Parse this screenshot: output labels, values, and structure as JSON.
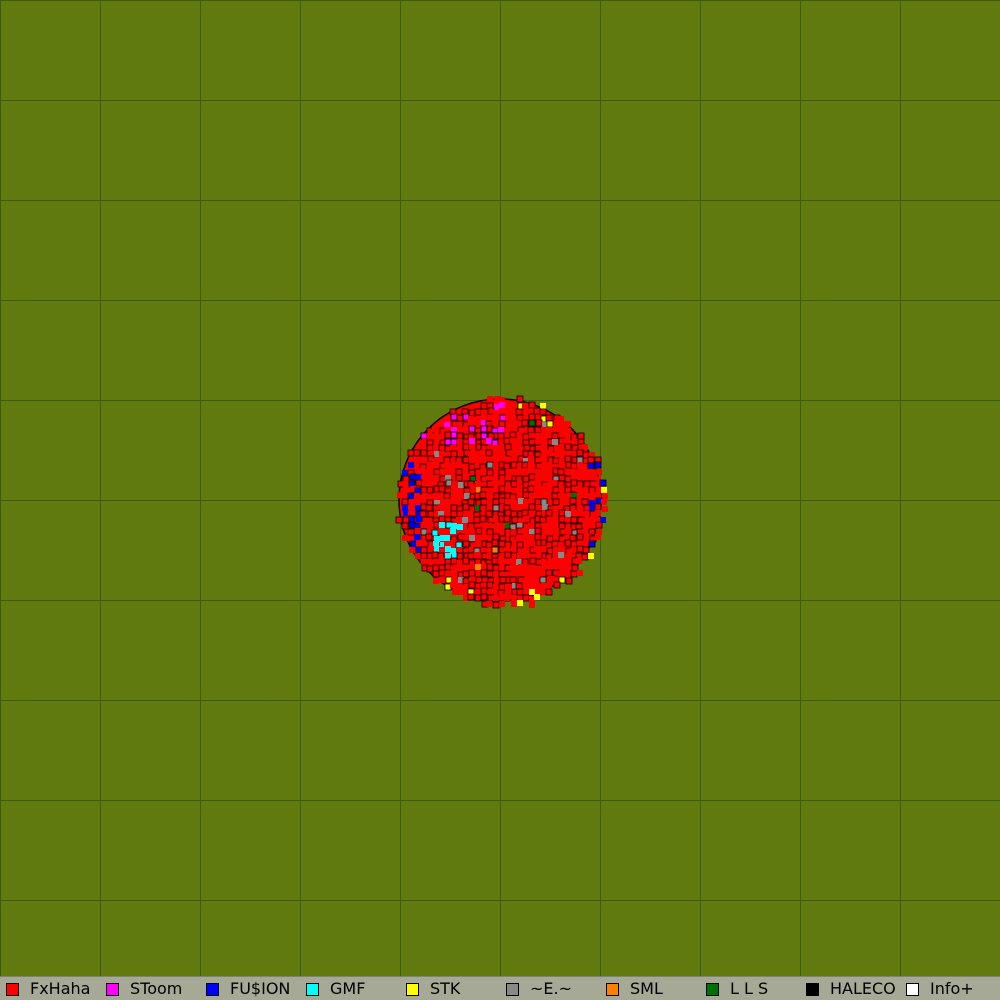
{
  "map": {
    "background_color": "#617a0d",
    "grid_color": "#3c5a10",
    "territory": {
      "dominant_player": "FxHaha",
      "dominant_color": "#ff0000",
      "outline_color": "#000000"
    }
  },
  "legend": {
    "players": [
      {
        "name": "FxHaha",
        "color": "#ff0000"
      },
      {
        "name": "SToom",
        "color": "#ff00ff"
      },
      {
        "name": "FU$ION",
        "color": "#0000ff"
      },
      {
        "name": "GMF",
        "color": "#00ffff"
      },
      {
        "name": "STK",
        "color": "#ffff00"
      },
      {
        "name": "~E.~",
        "color": "#888888"
      },
      {
        "name": "SML",
        "color": "#ff8000"
      },
      {
        "name": "L L S",
        "color": "#007000"
      },
      {
        "name": "HALECO",
        "color": "#000000"
      },
      {
        "name": "Info+",
        "color": "#ffffff"
      }
    ]
  }
}
